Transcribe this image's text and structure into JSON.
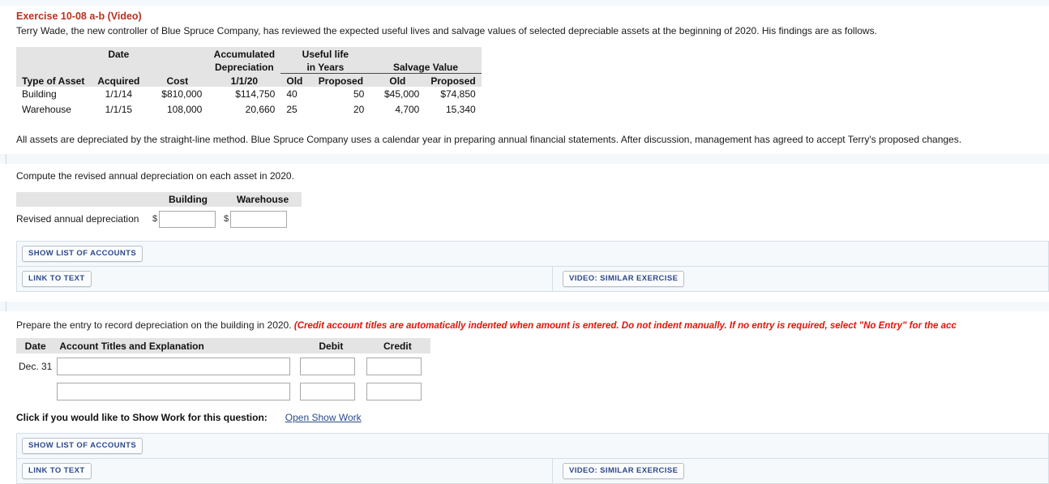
{
  "exercise": {
    "title": "Exercise 10-08 a-b (Video)",
    "intro": "Terry Wade, the new controller of Blue Spruce Company, has reviewed the expected useful lives and salvage values of selected depreciable assets at the beginning of 2020. His findings are as follows.",
    "note": "All assets are depreciated by the straight-line method. Blue Spruce Company uses a calendar year in preparing annual financial statements. After discussion, management has agreed to accept Terry's proposed changes."
  },
  "asset_table": {
    "group_headers": {
      "date": "Date",
      "accumulated": "Accumulated",
      "depreciation": "Depreciation",
      "useful_life": "Useful life",
      "in_years": "in Years",
      "salvage_value": "Salvage Value"
    },
    "columns": [
      "Type of Asset",
      "Acquired",
      "Cost",
      "1/1/20",
      "Old",
      "Proposed",
      "Old",
      "Proposed"
    ],
    "rows": [
      {
        "asset": "Building",
        "acquired": "1/1/14",
        "cost": "$810,000",
        "accum_dep": "$114,750",
        "life_old": "40",
        "life_proposed": "50",
        "salvage_old": "$45,000",
        "salvage_proposed": "$74,850"
      },
      {
        "asset": "Warehouse",
        "acquired": "1/1/15",
        "cost": "108,000",
        "accum_dep": "20,660",
        "life_old": "25",
        "life_proposed": "20",
        "salvage_old": "4,700",
        "salvage_proposed": "15,340"
      }
    ]
  },
  "part_a": {
    "prompt": "Compute the revised annual depreciation on each asset in 2020.",
    "col_building": "Building",
    "col_warehouse": "Warehouse",
    "row_label": "Revised annual depreciation",
    "currency_symbol": "$",
    "building_value": "",
    "warehouse_value": "",
    "building_placeholder": "",
    "warehouse_placeholder": "",
    "buttons": {
      "show_list_of_accounts": "SHOW LIST OF ACCOUNTS",
      "link_to_text": "LINK TO TEXT",
      "video_similar_exercise": "VIDEO: SIMILAR EXERCISE"
    }
  },
  "part_b": {
    "prompt": "Prepare the entry to record depreciation on the building in 2020.",
    "prompt_red": "(Credit account titles are automatically indented when amount is entered. Do not indent manually. If no entry is required, select \"No Entry\" for the acc",
    "columns": {
      "date": "Date",
      "account": "Account Titles and Explanation",
      "debit": "Debit",
      "credit": "Credit"
    },
    "rows": [
      {
        "date": "Dec. 31",
        "account": "",
        "debit": "",
        "credit": ""
      },
      {
        "date": "",
        "account": "",
        "debit": "",
        "credit": ""
      }
    ],
    "show_work_label": "Click if you would like to Show Work for this question:",
    "show_work_link": "Open Show Work",
    "buttons": {
      "show_list_of_accounts": "SHOW LIST OF ACCOUNTS",
      "link_to_text": "LINK TO TEXT",
      "video_similar_exercise": "VIDEO: SIMILAR EXERCISE"
    }
  },
  "colors": {
    "title_red": "#b8321e",
    "instruction_red": "#e8120b",
    "button_blue": "#2b4a8b",
    "table_header_gray": "#e4e4e4",
    "panel_blue": "#f5f9fc",
    "band_blue": "#f4f8fb"
  }
}
